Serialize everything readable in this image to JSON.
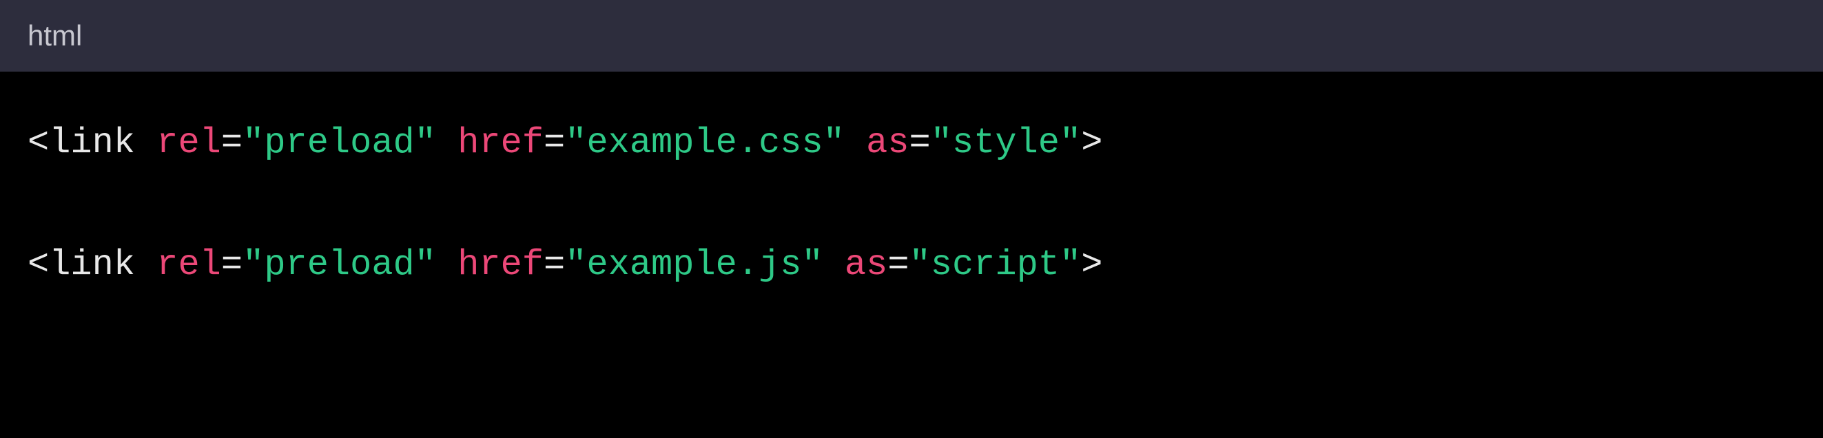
{
  "code_block": {
    "language": "html",
    "lines": [
      {
        "tokens": [
          {
            "type": "punct",
            "text": "<"
          },
          {
            "type": "tag",
            "text": "link"
          },
          {
            "type": "punct",
            "text": " "
          },
          {
            "type": "attr",
            "text": "rel"
          },
          {
            "type": "punct",
            "text": "="
          },
          {
            "type": "string",
            "text": "\"preload\""
          },
          {
            "type": "punct",
            "text": " "
          },
          {
            "type": "attr",
            "text": "href"
          },
          {
            "type": "punct",
            "text": "="
          },
          {
            "type": "string",
            "text": "\"example.css\""
          },
          {
            "type": "punct",
            "text": " "
          },
          {
            "type": "attr",
            "text": "as"
          },
          {
            "type": "punct",
            "text": "="
          },
          {
            "type": "string",
            "text": "\"style\""
          },
          {
            "type": "punct",
            "text": ">"
          }
        ]
      },
      {
        "tokens": [
          {
            "type": "punct",
            "text": "<"
          },
          {
            "type": "tag",
            "text": "link"
          },
          {
            "type": "punct",
            "text": " "
          },
          {
            "type": "attr",
            "text": "rel"
          },
          {
            "type": "punct",
            "text": "="
          },
          {
            "type": "string",
            "text": "\"preload\""
          },
          {
            "type": "punct",
            "text": " "
          },
          {
            "type": "attr",
            "text": "href"
          },
          {
            "type": "punct",
            "text": "="
          },
          {
            "type": "string",
            "text": "\"example.js\""
          },
          {
            "type": "punct",
            "text": " "
          },
          {
            "type": "attr",
            "text": "as"
          },
          {
            "type": "punct",
            "text": "="
          },
          {
            "type": "string",
            "text": "\"script\""
          },
          {
            "type": "punct",
            "text": ">"
          }
        ]
      }
    ]
  }
}
